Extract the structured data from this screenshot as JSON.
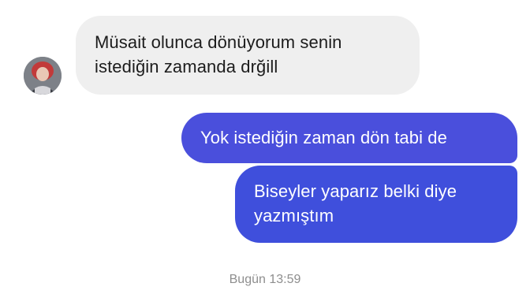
{
  "conversation": {
    "avatar_icon": "person-avatar-icon",
    "messages": [
      {
        "direction": "incoming",
        "lines": [
          "Müsait olunca dönüyorum senin",
          "istediğin zamanda drğill"
        ],
        "bubble_color": "#efefef",
        "text_color": "#1c1c1c"
      },
      {
        "direction": "outgoing",
        "lines": [
          "Yok istediğin zaman dön tabi de"
        ],
        "bubble_color": "#4a4fdc",
        "text_color": "#ffffff"
      },
      {
        "direction": "outgoing",
        "lines": [
          "Biseyler yaparız belki diye",
          "yazmıştım"
        ],
        "bubble_color": "#3f4fdc",
        "text_color": "#ffffff"
      }
    ],
    "timestamp": "Bugün 13:59"
  }
}
